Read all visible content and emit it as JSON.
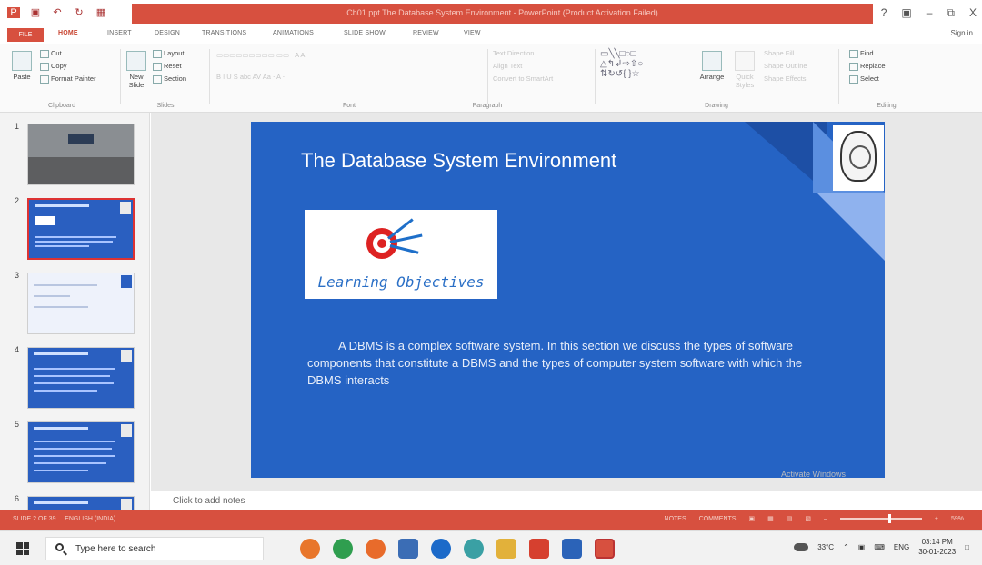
{
  "window": {
    "title": "Ch01.ppt The Database System Environment - PowerPoint (Product Activation Failed)",
    "help": "?",
    "minimize": "–",
    "restore": "ᵔ",
    "close": "X"
  },
  "ribbon_tabs": [
    "FILE",
    "HOME",
    "INSERT",
    "DESIGN",
    "TRANSITIONS",
    "ANIMATIONS",
    "SLIDE SHOW",
    "REVIEW",
    "VIEW"
  ],
  "sign_in": "Sign in",
  "ribbon": {
    "clipboard": {
      "paste": "Paste",
      "cut": "Cut",
      "copy": "Copy",
      "format_painter": "Format Painter",
      "label": "Clipboard"
    },
    "slides": {
      "new_slide": "New Slide",
      "layout": "Layout",
      "reset": "Reset",
      "section": "Section",
      "label": "Slides"
    },
    "font": {
      "label": "Font"
    },
    "paragraph": {
      "text_direction": "Text Direction",
      "align_text": "Align Text",
      "convert_smartart": "Convert to SmartArt",
      "label": "Paragraph"
    },
    "drawing": {
      "arrange": "Arrange",
      "quick_styles": "Quick Styles",
      "shape_fill": "Shape Fill",
      "shape_outline": "Shape Outline",
      "shape_effects": "Shape Effects",
      "label": "Drawing"
    },
    "editing": {
      "find": "Find",
      "replace": "Replace",
      "select": "Select",
      "label": "Editing"
    }
  },
  "thumbnails": [
    {
      "num": "1",
      "kind": "photo"
    },
    {
      "num": "2",
      "kind": "title",
      "selected": true
    },
    {
      "num": "3",
      "kind": "text"
    },
    {
      "num": "4",
      "kind": "blue"
    },
    {
      "num": "5",
      "kind": "blue"
    },
    {
      "num": "6",
      "kind": "blue"
    }
  ],
  "slide": {
    "title": "The Database System Environment",
    "image_caption": "Learning Objectives",
    "body": "A DBMS is a complex software system. In this section we discuss the types of software components that constitute a DBMS and the types of computer system software with which the DBMS interacts"
  },
  "notes_placeholder": "Click to add notes",
  "watermark": "Activate Windows",
  "statusbar": {
    "slide_info": "SLIDE 2 OF 39",
    "language": "ENGLISH (INDIA)",
    "notes": "NOTES",
    "comments": "COMMENTS",
    "zoom": "59%"
  },
  "taskbar": {
    "search_placeholder": "Type here to search",
    "weather": "33°C",
    "language": "ENG",
    "time": "03:14 PM",
    "date": "30-01-2023"
  },
  "colors": {
    "accent": "#d7503f",
    "slide_bg": "#2563c4"
  }
}
